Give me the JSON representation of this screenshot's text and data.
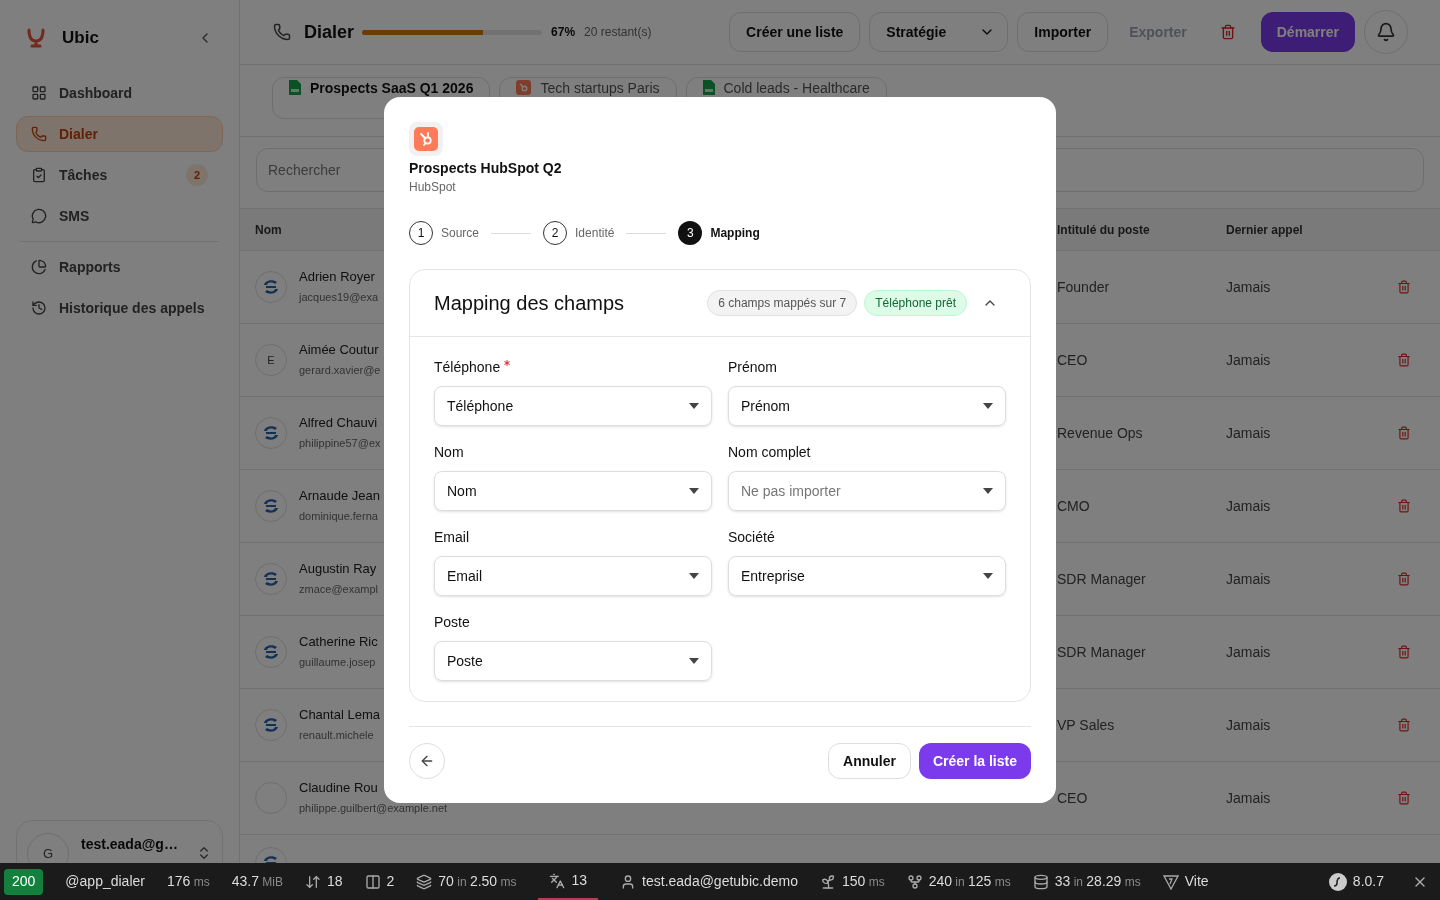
{
  "sidebar": {
    "brand": "Ubic",
    "items": [
      {
        "label": "Dashboard",
        "kind": "dashboard",
        "selected": false
      },
      {
        "label": "Dialer",
        "kind": "phone",
        "selected": true
      },
      {
        "label": "Tâches",
        "kind": "tasks",
        "selected": false,
        "badge": "2"
      },
      {
        "label": "SMS",
        "kind": "sms",
        "selected": false
      },
      {
        "kind": "divider"
      },
      {
        "label": "Rapports",
        "kind": "reports",
        "selected": false
      },
      {
        "label": "Historique des appels",
        "kind": "history",
        "selected": false
      }
    ],
    "user": {
      "initial": "G",
      "email": "test.eada@g…"
    }
  },
  "header": {
    "title": "Dialer",
    "progress": {
      "level": 0.67,
      "percent": "67%",
      "remaining": "20 restant(s)"
    },
    "actions": [
      {
        "label": "Créer une liste",
        "kind": "button"
      },
      {
        "label": "Stratégie",
        "kind": "dropdown"
      },
      {
        "label": "Importer",
        "kind": "button"
      },
      {
        "label": "Exporter",
        "kind": "link",
        "disabled": true
      },
      {
        "kind": "delete"
      },
      {
        "label": "Démarrer",
        "kind": "primary"
      },
      {
        "kind": "notifications"
      }
    ]
  },
  "list_tabs": [
    {
      "label": "Prospects SaaS Q1 2026",
      "kind": "csv",
      "selected": true
    },
    {
      "label": "Tech startups Paris",
      "kind": "hubspot",
      "selected": false
    },
    {
      "label": "Cold leads - Healthcare",
      "kind": "csv",
      "selected": false
    }
  ],
  "search": {
    "placeholder": "Rechercher"
  },
  "table": {
    "columns": [
      "Nom",
      "Intitulé du poste",
      "Dernier appel"
    ],
    "rows": [
      {
        "name": "Adrien Royer",
        "email": "jacques19@exa",
        "kind": "logo",
        "title": "Founder",
        "last_call": "Jamais"
      },
      {
        "name": "Aimée Coutur",
        "email": "gerard.xavier@e",
        "kind": "letter",
        "initial": "E",
        "title": "CEO",
        "last_call": "Jamais"
      },
      {
        "name": "Alfred Chauvi",
        "email": "philippine57@ex",
        "kind": "logo",
        "title": "Revenue Ops",
        "last_call": "Jamais"
      },
      {
        "name": "Arnaude Jean",
        "email": "dominique.ferna",
        "kind": "logo",
        "title": "CMO",
        "last_call": "Jamais"
      },
      {
        "name": "Augustin Ray",
        "email": "zmace@exampl",
        "kind": "logo",
        "title": "SDR Manager",
        "last_call": "Jamais"
      },
      {
        "name": "Catherine Ric",
        "email": "guillaume.josep",
        "kind": "logo",
        "title": "SDR Manager",
        "last_call": "Jamais"
      },
      {
        "name": "Chantal Lema",
        "email": "renault.michele",
        "kind": "logo",
        "title": "VP Sales",
        "last_call": "Jamais"
      },
      {
        "name": "Claudine Rou",
        "email": "philippe.guilbert@example.net",
        "kind": "empty",
        "title": "CEO",
        "last_call": "Jamais"
      }
    ]
  },
  "modal": {
    "source_name": "Prospects HubSpot Q2",
    "source": "HubSpot",
    "steps": [
      {
        "number": "1",
        "label": "Source",
        "selected": false
      },
      {
        "number": "2",
        "label": "Identité",
        "selected": false
      },
      {
        "number": "3",
        "label": "Mapping",
        "selected": true
      }
    ],
    "card": {
      "title": "Mapping des champs",
      "expanded": true,
      "badges": [
        {
          "label": "6 champs mappés sur 7",
          "kind": "count"
        },
        {
          "label": "Téléphone prêt",
          "kind": "success"
        }
      ],
      "fields": [
        {
          "label": "Téléphone",
          "required": true,
          "value": "Téléphone"
        },
        {
          "label": "Prénom",
          "required": false,
          "value": "Prénom"
        },
        {
          "label": "Nom",
          "required": false,
          "value": "Nom"
        },
        {
          "label": "Nom complet",
          "required": false,
          "placeholder": "Ne pas importer"
        },
        {
          "label": "Email",
          "required": false,
          "value": "Email"
        },
        {
          "label": "Société",
          "required": false,
          "value": "Entreprise"
        },
        {
          "label": "Poste",
          "required": false,
          "value": "Poste"
        }
      ]
    },
    "buttons": [
      {
        "label": "Annuler",
        "kind": "secondary"
      },
      {
        "label": "Créer la liste",
        "kind": "primary"
      }
    ]
  },
  "status_bar": [
    {
      "kind": "status",
      "value": "200"
    },
    {
      "kind": "route",
      "value": "@app_dialer"
    },
    {
      "kind": "time",
      "value": "176",
      "unit": "ms"
    },
    {
      "kind": "memory",
      "value": "43.7",
      "unit": "MiB"
    },
    {
      "kind": "requests",
      "value": "18"
    },
    {
      "kind": "forms",
      "value": "2"
    },
    {
      "kind": "layers",
      "value": "70",
      "joiner": "in",
      "duration": "2.50",
      "unit": "ms"
    },
    {
      "kind": "translation",
      "value": "13",
      "selected": true
    },
    {
      "kind": "user",
      "value": "test.eada@getubic.demo"
    },
    {
      "kind": "events",
      "value": "150",
      "unit": "ms"
    },
    {
      "kind": "workflow",
      "value": "240",
      "joiner": "in",
      "duration": "125",
      "unit": "ms"
    },
    {
      "kind": "database",
      "value": "33",
      "joiner": "in",
      "duration": "28.29",
      "unit": "ms"
    },
    {
      "kind": "vite",
      "value": "Vite"
    },
    {
      "kind": "version",
      "value": "8.0.7"
    }
  ]
}
